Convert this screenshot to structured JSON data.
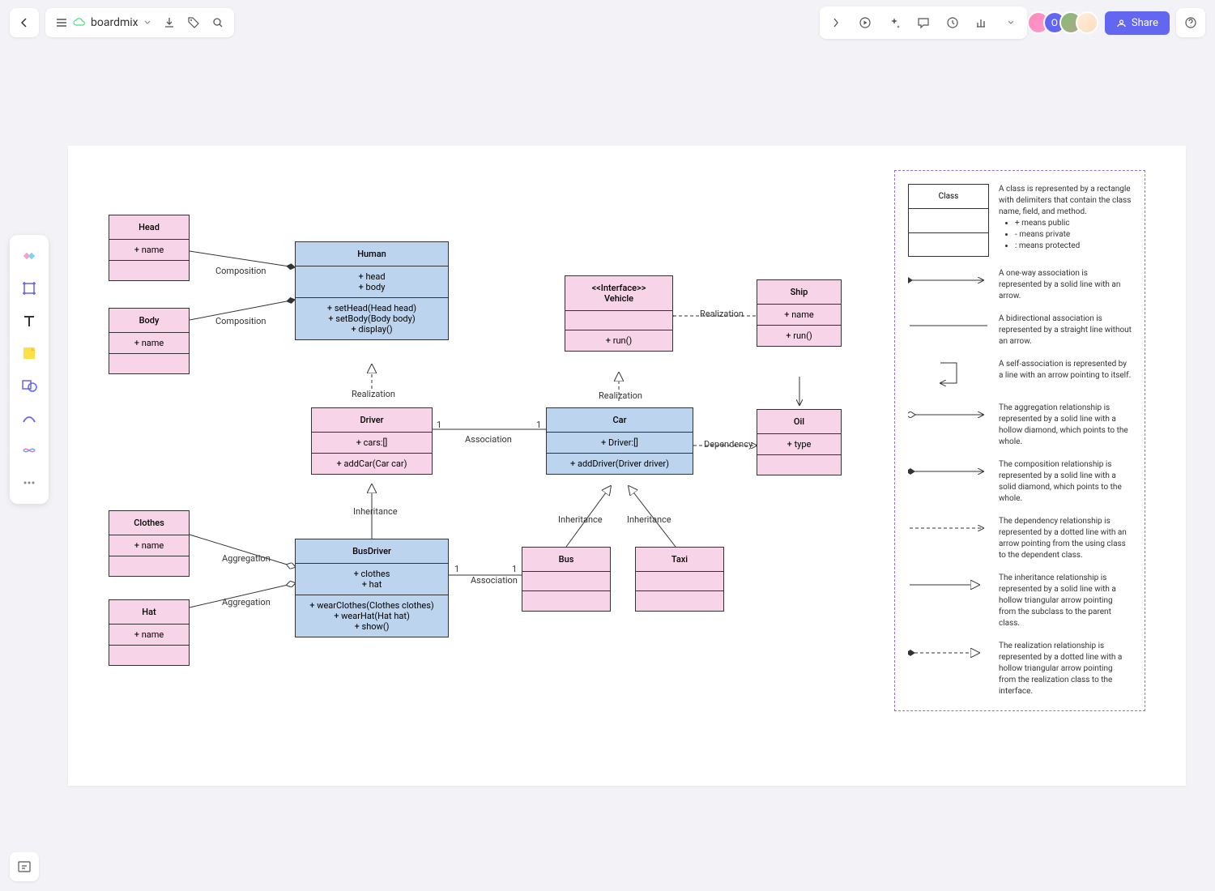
{
  "header": {
    "title": "boardmix",
    "share": "Share"
  },
  "classes": {
    "head": {
      "name": "Head",
      "attrs": "+ name"
    },
    "body": {
      "name": "Body",
      "attrs": "+ name"
    },
    "human": {
      "name": "Human",
      "attrs": "+ head\n+ body",
      "methods": "+ setHead(Head head)\n+ setBody(Body body)\n+ display()"
    },
    "driver": {
      "name": "Driver",
      "attrs": "+ cars:[]",
      "methods": "+ addCar(Car car)"
    },
    "clothes": {
      "name": "Clothes",
      "attrs": "+ name"
    },
    "hat": {
      "name": "Hat",
      "attrs": "+ name"
    },
    "busdriver": {
      "name": "BusDriver",
      "attrs": "+ clothes\n+ hat",
      "methods": "+ wearClothes(Clothes clothes)\n+ wearHat(Hat hat)\n+ show()"
    },
    "vehicle": {
      "stereo": "<<Interface>>",
      "name": "Vehicle",
      "methods": "+ run()"
    },
    "car": {
      "name": "Car",
      "attrs": "+ Driver:[]",
      "methods": "+ addDriver(Driver driver)"
    },
    "bus": {
      "name": "Bus"
    },
    "taxi": {
      "name": "Taxi"
    },
    "ship": {
      "name": "Ship",
      "attrs": "+ name",
      "methods": "+ run()"
    },
    "oil": {
      "name": "Oil",
      "attrs": "+ type"
    }
  },
  "labels": {
    "composition": "Composition",
    "realization": "Realization",
    "association": "Association",
    "inheritance": "Inheritance",
    "aggregation": "Aggregation",
    "dependency": "Dependency",
    "one": "1"
  },
  "legend": {
    "class_title": "Class",
    "class_desc": "A class is represented by a rectangle with delimiters that contain the class name, field, and method.",
    "public": "+ means public",
    "private": "- means private",
    "protected": ": means protected",
    "assoc": "A one-way association is represented by a solid line with an arrow.",
    "bidir": "A bidirectional association is represented by a straight line without an arrow.",
    "self": "A self-association is represented by a line with an arrow pointing to itself.",
    "agg": "The aggregation relationship is represented by a solid line with a hollow diamond, which points to the whole.",
    "comp": "The composition relationship is represented by a solid line with a solid diamond, which points to the whole.",
    "dep": "The dependency relationship is represented by a dotted line with an arrow pointing from the using class to the dependent class.",
    "inh": "The inheritance relationship is represented by a solid line with a hollow triangular arrow pointing from the subclass to the parent class.",
    "real": "The realization relationship is represented by a dotted line with a hollow triangular arrow pointing from the realization class to the interface."
  }
}
